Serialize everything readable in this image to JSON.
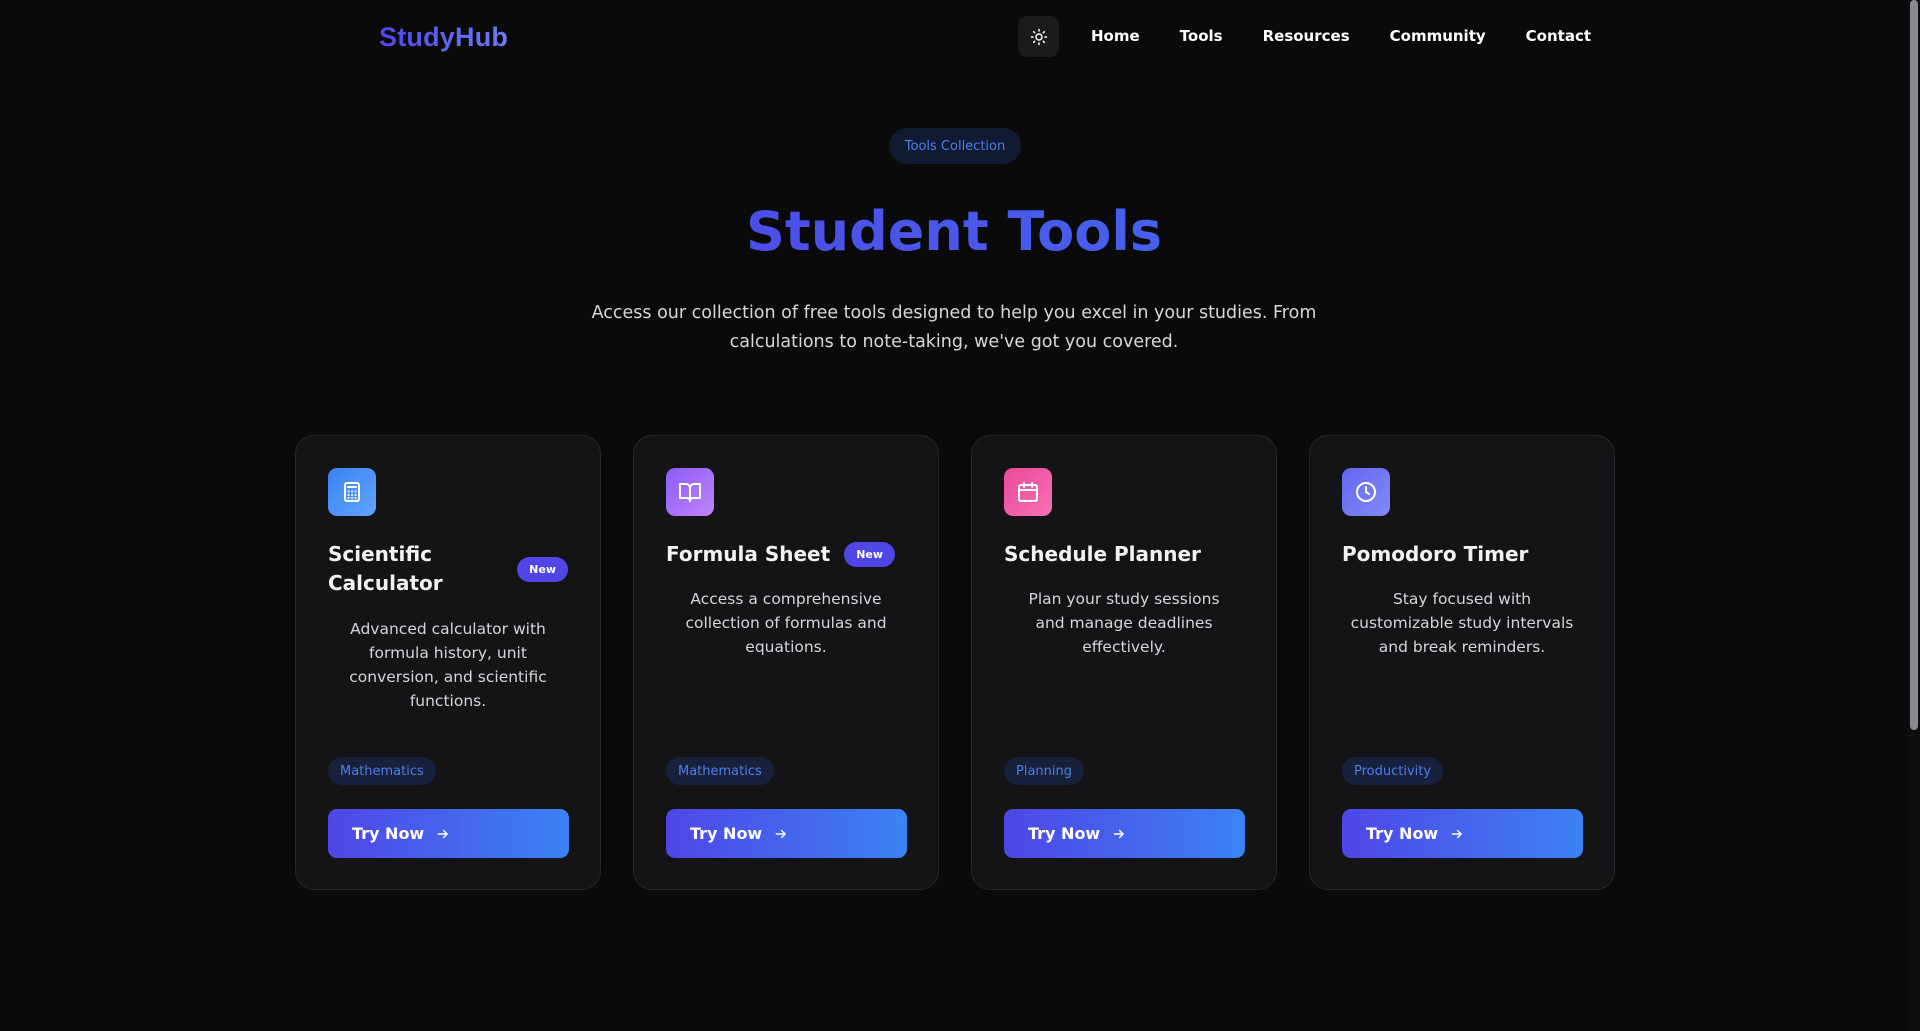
{
  "header": {
    "logo": "StudyHub",
    "nav": [
      "Home",
      "Tools",
      "Resources",
      "Community",
      "Contact"
    ]
  },
  "hero": {
    "pill": "Tools Collection",
    "title": "Student Tools",
    "subtitle": "Access our collection of free tools designed to help you excel in your studies. From calculations to note-taking, we've got you covered."
  },
  "cards": [
    {
      "icon": "calculator-icon",
      "title": "Scientific Calculator",
      "badge": "New",
      "description": "Advanced calculator with formula history, unit conversion, and scientific functions.",
      "tag": "Mathematics",
      "button": "Try Now",
      "icon_gradient": [
        "#3b82f6",
        "#60a5fa"
      ]
    },
    {
      "icon": "book-icon",
      "title": "Formula Sheet",
      "badge": "New",
      "description": "Access a comprehensive collection of formulas and equations.",
      "tag": "Mathematics",
      "button": "Try Now",
      "icon_gradient": [
        "#8b5cf6",
        "#c084fc"
      ]
    },
    {
      "icon": "calendar-icon",
      "title": "Schedule Planner",
      "badge": "",
      "description": "Plan your study sessions and manage deadlines effectively.",
      "tag": "Planning",
      "button": "Try Now",
      "icon_gradient": [
        "#ec4899",
        "#f472b6"
      ]
    },
    {
      "icon": "clock-icon",
      "title": "Pomodoro Timer",
      "badge": "",
      "description": "Stay focused with customizable study intervals and break reminders.",
      "tag": "Productivity",
      "button": "Try Now",
      "icon_gradient": [
        "#6366f1",
        "#818cf8"
      ]
    }
  ],
  "colors": {
    "accent": "#4f46e5",
    "accent_blue": "#3b82f6",
    "background": "#0a0a0b",
    "card": "#141416"
  }
}
